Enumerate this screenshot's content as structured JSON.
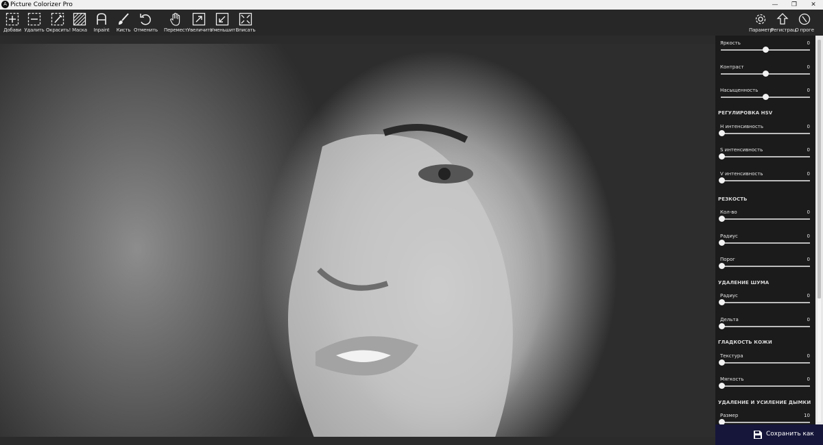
{
  "window": {
    "title": "Picture Colorizer Pro",
    "app_icon_letter": "A",
    "controls": [
      "—",
      "❐",
      "✕"
    ]
  },
  "toolbar": {
    "left_tools": [
      {
        "label": "Добави",
        "icon": "add-square-icon"
      },
      {
        "label": "Удалить",
        "icon": "remove-square-icon"
      },
      {
        "label": "Окрасить!",
        "icon": "colorize-icon"
      },
      {
        "label": "Маска",
        "icon": "mask-icon"
      },
      {
        "label": "Inpaint",
        "icon": "inpaint-icon"
      },
      {
        "label": "Кисть",
        "icon": "brush-icon"
      },
      {
        "label": "Отменить",
        "icon": "undo-icon"
      },
      {
        "label": "Перемест",
        "icon": "hand-icon"
      },
      {
        "label": "Увеличить",
        "icon": "zoom-in-icon"
      },
      {
        "label": "Уменьшит",
        "icon": "zoom-out-icon"
      },
      {
        "label": "Вписать",
        "icon": "fit-icon"
      }
    ],
    "right_tools": [
      {
        "label": "Параметр",
        "icon": "gear-icon"
      },
      {
        "label": "Регистрац",
        "icon": "upload-icon"
      },
      {
        "label": "О проге",
        "icon": "about-icon"
      }
    ]
  },
  "panel": {
    "basic": [
      {
        "name": "Яркость",
        "value": "0",
        "level": 0.5
      },
      {
        "name": "Контраст",
        "value": "0",
        "level": 0.5
      },
      {
        "name": "Насыщенность",
        "value": "0",
        "level": 0.5
      }
    ],
    "hsv": {
      "title": "РЕГУЛИРОВКА HSV",
      "items": [
        {
          "name": "H интенсивность",
          "value": "0",
          "level": 0
        },
        {
          "name": "S интенсивность",
          "value": "0",
          "level": 0
        },
        {
          "name": "V интенсивность",
          "value": "0",
          "level": 0
        }
      ]
    },
    "sharpness": {
      "title": "РЕЗКОСТЬ",
      "items": [
        {
          "name": "Кол-во",
          "value": "0",
          "level": 0
        },
        {
          "name": "Радиус",
          "value": "0",
          "level": 0
        },
        {
          "name": "Порог",
          "value": "0",
          "level": 0
        }
      ]
    },
    "denoise": {
      "title": "УДАЛЕНИЕ ШУМА",
      "items": [
        {
          "name": "Радиус",
          "value": "0",
          "level": 0
        },
        {
          "name": "Дельта",
          "value": "0",
          "level": 0
        }
      ]
    },
    "skin": {
      "title": "ГЛАДКОСТЬ КОЖИ",
      "items": [
        {
          "name": "Текстура",
          "value": "0",
          "level": 0
        },
        {
          "name": "Мягкость",
          "value": "0",
          "level": 0
        }
      ]
    },
    "dehaze": {
      "title": "УДАЛЕНИЕ И УСИЛЕНИЕ ДЫМКИ",
      "items": [
        {
          "name": "Размер",
          "value": "10",
          "level": 0
        }
      ]
    }
  },
  "save_button": {
    "label": "Сохранить как",
    "icon": "save-disk-icon"
  },
  "colors": {
    "panel_bg": "#1b1b1b",
    "toolbar_bg": "#272727",
    "save_bg": "#16163a"
  }
}
